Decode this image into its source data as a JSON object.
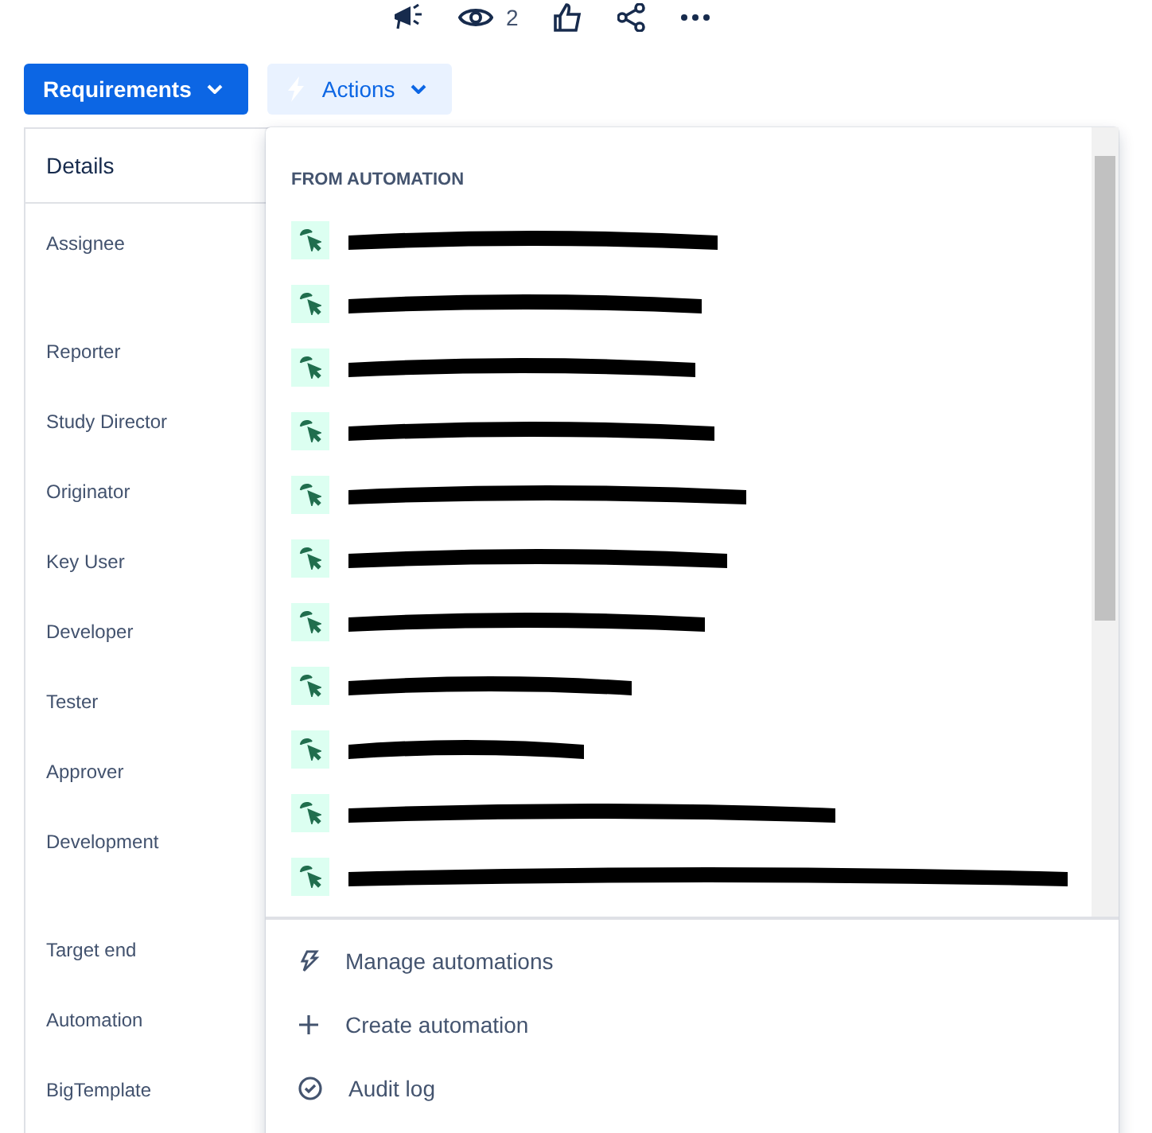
{
  "toolbar": {
    "watchers": "2"
  },
  "buttons": [
    {
      "label": "Requirements",
      "kind": "primary"
    },
    {
      "label": "Actions",
      "kind": "subtle"
    }
  ],
  "details": {
    "title": "Details",
    "fields": [
      {
        "label": "Assignee",
        "kind": "tall"
      },
      {
        "label": "Reporter",
        "kind": "normal"
      },
      {
        "label": "Study Director",
        "kind": "normal"
      },
      {
        "label": "Originator",
        "kind": "normal"
      },
      {
        "label": "Key User",
        "kind": "normal"
      },
      {
        "label": "Developer",
        "kind": "normal"
      },
      {
        "label": "Tester",
        "kind": "normal"
      },
      {
        "label": "Approver",
        "kind": "normal"
      },
      {
        "label": "Development",
        "kind": "tall"
      },
      {
        "label": "Target end",
        "kind": "normal"
      },
      {
        "label": "Automation",
        "kind": "normal"
      },
      {
        "label": "BigTemplate",
        "kind": "normal"
      }
    ]
  },
  "menu": {
    "section": "FROM AUTOMATION",
    "rules": [
      {
        "redacted": true
      },
      {
        "redacted": true
      },
      {
        "redacted": true
      },
      {
        "redacted": true
      },
      {
        "redacted": true
      },
      {
        "redacted": true
      },
      {
        "redacted": true
      },
      {
        "redacted": true
      },
      {
        "redacted": true
      },
      {
        "redacted": true
      },
      {
        "redacted": true
      }
    ],
    "footer": [
      {
        "label": "Manage automations",
        "kind": "manage"
      },
      {
        "label": "Create automation",
        "kind": "create"
      },
      {
        "label": "Audit log",
        "kind": "audit"
      }
    ]
  }
}
